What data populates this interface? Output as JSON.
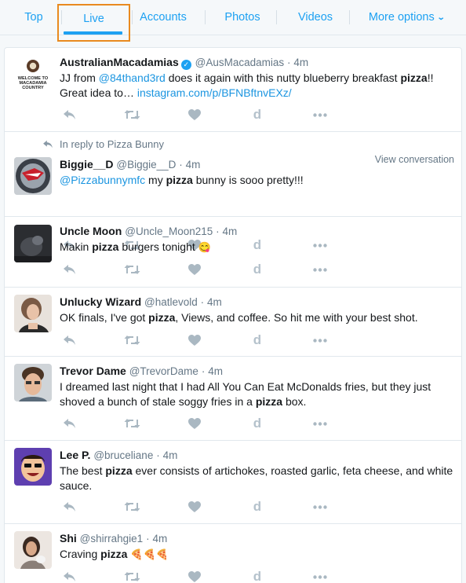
{
  "tabs": {
    "top": "Top",
    "live": "Live",
    "accounts": "Accounts",
    "photos": "Photos",
    "videos": "Videos",
    "more": "More options"
  },
  "accent_color": "#1da1f2",
  "highlight_color": "#e98a1f",
  "tweets": [
    {
      "fullname": "AustralianMacadamias",
      "verified": true,
      "username": "@AusMacadamias",
      "time": "4m",
      "text_before": "JJ from ",
      "mention": "@84thand3rd",
      "text_mid": " does it again with this nutty blueberry breakfast ",
      "keyword": "pizza",
      "text_after": "!! Great idea to… ",
      "link": "instagram.com/p/BFNBftnvEXz/",
      "avatar_text": "WELCOME TO MACADAMIA COUNTRY"
    },
    {
      "context": "In reply to Pizza Bunny",
      "fullname": "Biggie__D",
      "username": "@Biggie__D",
      "time": "4m",
      "mention": "@Pizzabunnymfc",
      "text_before": " my ",
      "keyword": "pizza",
      "text_after": " bunny is sooo pretty!!!",
      "view_conversation": "View conversation"
    },
    {
      "fullname": "Uncle Moon",
      "username": "@Uncle_Moon215",
      "time": "4m",
      "text_before": "Makin ",
      "keyword": "pizza",
      "text_after": " burgers tonight ",
      "emoji": "😋"
    },
    {
      "fullname": "Unlucky Wizard",
      "username": "@hatlevold",
      "time": "4m",
      "text_before": "OK finals, I've got ",
      "keyword": "pizza",
      "text_after": ", Views, and coffee. So hit me with your best shot."
    },
    {
      "fullname": "Trevor Dame",
      "username": "@TrevorDame",
      "time": "4m",
      "text_before": "I dreamed last night that I had All You Can Eat McDonalds fries, but they just shoved a bunch of stale soggy fries in a ",
      "keyword": "pizza",
      "text_after": " box."
    },
    {
      "fullname": "Lee P.",
      "username": "@bruceliane",
      "time": "4m",
      "text_before": "The best ",
      "keyword": "pizza",
      "text_after": " ever consists of artichokes, roasted garlic, feta cheese, and white sauce."
    },
    {
      "fullname": "Shi",
      "username": "@shirrahgie1",
      "time": "4m",
      "text_before": "Craving ",
      "keyword": "pizza",
      "text_after": " ",
      "emoji": "🍕🍕🍕"
    }
  ],
  "dot": "·",
  "action_icons": [
    "reply-icon",
    "retweet-icon",
    "like-icon",
    "d-icon",
    "more-icon"
  ]
}
